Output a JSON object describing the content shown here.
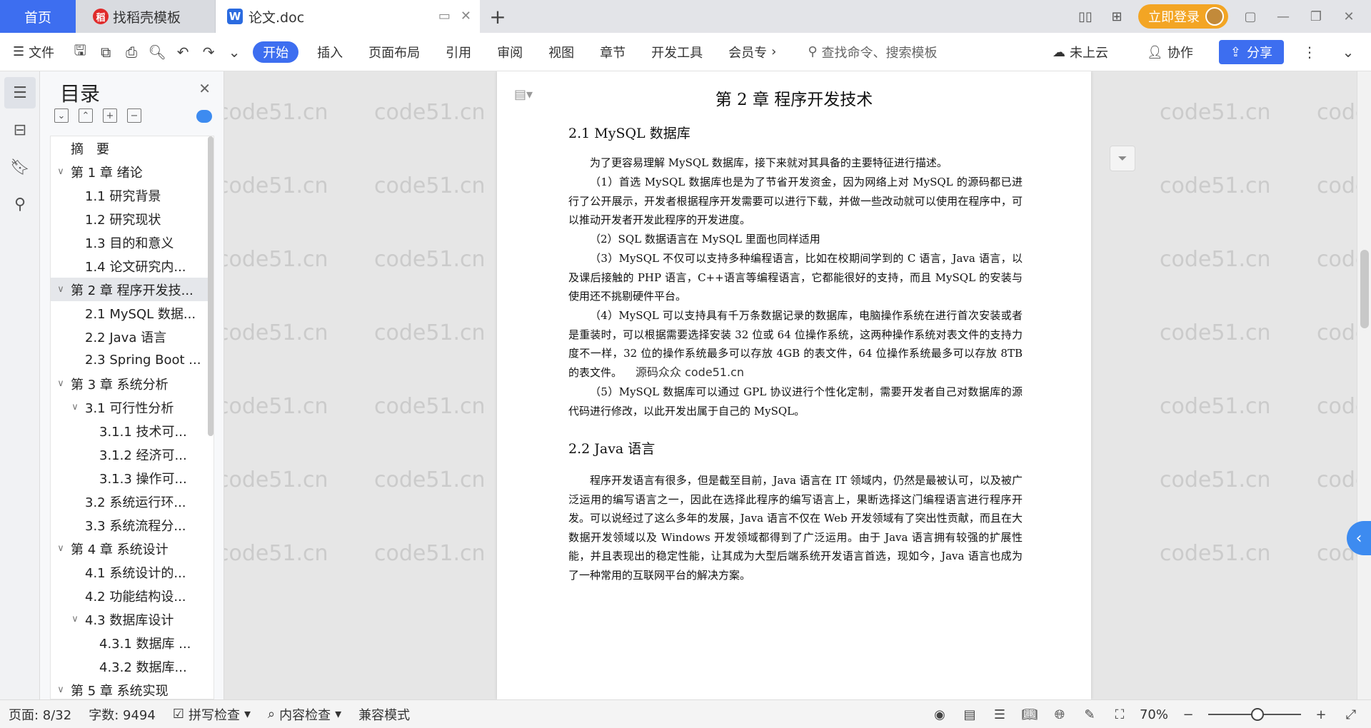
{
  "tabs": {
    "home": "首页",
    "docer": "找稻壳模板",
    "doc": "论文.doc",
    "add": "+"
  },
  "account": {
    "login": "立即登录"
  },
  "ribbon": {
    "file": "文件",
    "tabs": [
      "开始",
      "插入",
      "页面布局",
      "引用",
      "审阅",
      "视图",
      "章节",
      "开发工具",
      "会员专"
    ],
    "search_placeholder": "查找命令、搜索模板",
    "cloud": "未上云",
    "collab": "协作",
    "share": "分享"
  },
  "toc": {
    "title": "目录",
    "items": [
      {
        "label": "摘　要",
        "level": 0,
        "arrow": ""
      },
      {
        "label": "第 1 章  绪论",
        "level": 0,
        "arrow": "∨"
      },
      {
        "label": "1.1  研究背景",
        "level": 1,
        "arrow": ""
      },
      {
        "label": "1.2  研究现状",
        "level": 1,
        "arrow": ""
      },
      {
        "label": "1.3  目的和意义",
        "level": 1,
        "arrow": ""
      },
      {
        "label": "1.4  论文研究内...",
        "level": 1,
        "arrow": ""
      },
      {
        "label": "第 2 章  程序开发技...",
        "level": 0,
        "arrow": "∨"
      },
      {
        "label": "2.1 MySQL 数据...",
        "level": 1,
        "arrow": ""
      },
      {
        "label": "2.2 Java 语言",
        "level": 1,
        "arrow": ""
      },
      {
        "label": "2.3 Spring Boot ...",
        "level": 1,
        "arrow": ""
      },
      {
        "label": "第 3 章  系统分析",
        "level": 0,
        "arrow": "∨"
      },
      {
        "label": "3.1 可行性分析",
        "level": 1,
        "arrow": "∨"
      },
      {
        "label": "3.1.1 技术可...",
        "level": 2,
        "arrow": ""
      },
      {
        "label": "3.1.2 经济可...",
        "level": 2,
        "arrow": ""
      },
      {
        "label": "3.1.3 操作可...",
        "level": 2,
        "arrow": ""
      },
      {
        "label": "3.2 系统运行环...",
        "level": 1,
        "arrow": ""
      },
      {
        "label": "3.3 系统流程分...",
        "level": 1,
        "arrow": ""
      },
      {
        "label": "第 4 章  系统设计",
        "level": 0,
        "arrow": "∨"
      },
      {
        "label": "4.1  系统设计的...",
        "level": 1,
        "arrow": ""
      },
      {
        "label": "4.2  功能结构设...",
        "level": 1,
        "arrow": ""
      },
      {
        "label": "4.3  数据库设计",
        "level": 1,
        "arrow": "∨"
      },
      {
        "label": "4.3.1  数据库 ...",
        "level": 2,
        "arrow": ""
      },
      {
        "label": "4.3.2  数据库...",
        "level": 2,
        "arrow": ""
      },
      {
        "label": "第 5 章  系统实现",
        "level": 0,
        "arrow": "∨"
      }
    ],
    "selected_index": 6
  },
  "document": {
    "chapter_title": "第 2 章  程序开发技术",
    "sec1_title": "2.1 MySQL 数据库",
    "sec1_paragraphs": [
      "为了更容易理解 MySQL 数据库，接下来就对其具备的主要特征进行描述。",
      "（1）首选 MySQL 数据库也是为了节省开发资金，因为网络上对 MySQL 的源码都已进行了公开展示，开发者根据程序开发需要可以进行下载，并做一些改动就可以使用在程序中，可以推动开发者开发此程序的开发进度。",
      "（2）SQL 数据语言在 MySQL 里面也同样适用",
      "（3）MySQL 不仅可以支持多种编程语言，比如在校期间学到的 C 语言，Java 语言，以及课后接触的 PHP 语言，C++语言等编程语言，它都能很好的支持，而且 MySQL 的安装与使用还不挑剔硬件平台。",
      "（4）MySQL 可以支持具有千万条数据记录的数据库，电脑操作系统在进行首次安装或者是重装时，可以根据需要选择安装 32 位或 64 位操作系统，这两种操作系统对表文件的支持力度不一样，32 位的操作系统最多可以存放 4GB 的表文件，64 位操作系统最多可以存放 8TB 的表文件。",
      "（5）MySQL 数据库可以通过 GPL 协议进行个性化定制，需要开发者自己对数据库的源代码进行修改，以此开发出属于自己的 MySQL。"
    ],
    "sec2_title": "2.2 Java 语言",
    "sec2_paragraph": "程序开发语言有很多，但是截至目前，Java 语言在 IT 领域内，仍然是最被认可，以及被广泛运用的编写语言之一，因此在选择此程序的编写语言上，果断选择这门编程语言进行程序开发。可以说经过了这么多年的发展，Java 语言不仅在 Web 开发领域有了突出性贡献，而且在大数据开发领域以及 Windows 开发领域都得到了广泛运用。由于 Java 语言拥有较强的扩展性能，并且表现出的稳定性能，让其成为大型后端系统开发语言首选，现如今，Java 语言也成为了一种常用的互联网平台的解决方案。",
    "floating_note": "源码众众 code51.cn"
  },
  "watermark": "code51.cn",
  "status": {
    "page": "页面: 8/32",
    "words": "字数: 9494",
    "spell": "拼写检查",
    "content_check": "内容检查",
    "compat": "兼容模式",
    "zoom": "70%"
  },
  "colors": {
    "accent": "#3d6ef0",
    "login": "#f3a524"
  }
}
